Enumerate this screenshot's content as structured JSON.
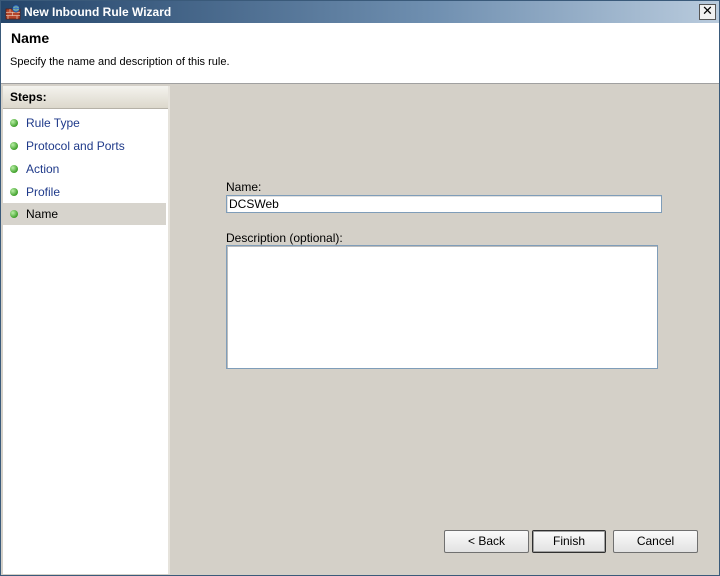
{
  "window": {
    "title": "New Inbound Rule Wizard",
    "close_glyph": "✕"
  },
  "header": {
    "title": "Name",
    "subtitle": "Specify the name and description of this rule."
  },
  "steps": {
    "header": "Steps:",
    "items": [
      {
        "label": "Rule Type"
      },
      {
        "label": "Protocol and Ports"
      },
      {
        "label": "Action"
      },
      {
        "label": "Profile"
      },
      {
        "label": "Name"
      }
    ],
    "active_index": 4
  },
  "form": {
    "name_label": "Name:",
    "name_value": "DCSWeb",
    "description_label": "Description (optional):",
    "description_value": ""
  },
  "buttons": {
    "back": "< Back",
    "finish": "Finish",
    "cancel": "Cancel"
  },
  "colors": {
    "title_bar": "#24456a",
    "step_dot": "#3f9f2a",
    "step_link": "#1f3a8a",
    "panel_bg": "#d4d0c8"
  },
  "icons": {
    "app": "firewall-icon",
    "step": "green-dot-icon",
    "close": "close-icon"
  }
}
